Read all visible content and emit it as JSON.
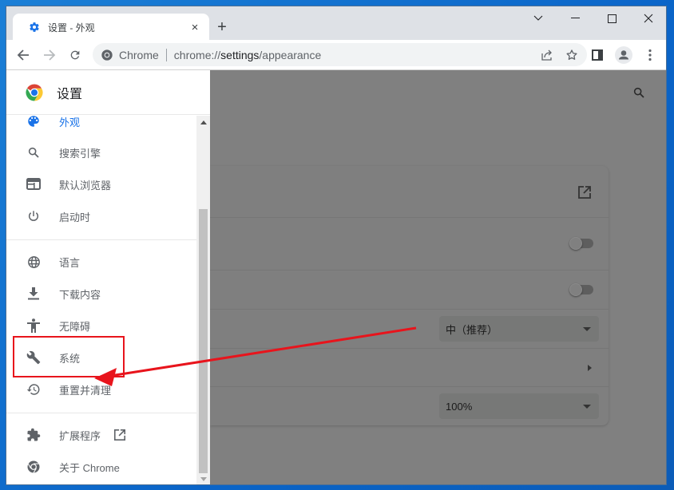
{
  "browser": {
    "tab": {
      "title": "设置 - 外观",
      "favicon": "gear-icon",
      "close_label": "×"
    },
    "new_tab_label": "+",
    "window_controls": [
      "tab-search",
      "minimize",
      "maximize",
      "close"
    ],
    "omnibox": {
      "site_label": "Chrome",
      "url_prefix": "chrome://",
      "url_host": "settings",
      "url_path": "/appearance"
    },
    "toolbar_icons": [
      "share-icon",
      "bookmark-star-icon",
      "side-panel-icon",
      "profile-avatar-icon",
      "more-menu-icon"
    ]
  },
  "settings": {
    "header_title": "设置",
    "nav_items": [
      {
        "label": "外观",
        "icon": "palette-icon",
        "active": true
      },
      {
        "label": "搜索引擎",
        "icon": "search-icon"
      },
      {
        "label": "默认浏览器",
        "icon": "browser-window-icon"
      },
      {
        "label": "启动时",
        "icon": "power-icon"
      },
      {
        "label": "语言",
        "icon": "globe-icon"
      },
      {
        "label": "下载内容",
        "icon": "download-icon"
      },
      {
        "label": "无障碍",
        "icon": "accessibility-icon"
      },
      {
        "label": "系统",
        "icon": "wrench-icon",
        "highlighted": true
      },
      {
        "label": "重置并清理",
        "icon": "history-reset-icon"
      },
      {
        "label": "扩展程序",
        "icon": "puzzle-icon",
        "external": true
      },
      {
        "label": "关于 Chrome",
        "icon": "chrome-logo-icon"
      }
    ],
    "main": {
      "toggles": [
        {
          "on": false
        },
        {
          "on": false
        }
      ],
      "font_size_select": "中（推荐）",
      "page_zoom_select": "100%"
    }
  },
  "annotation": {
    "color": "#e8141c",
    "highlight_target": "系统"
  }
}
